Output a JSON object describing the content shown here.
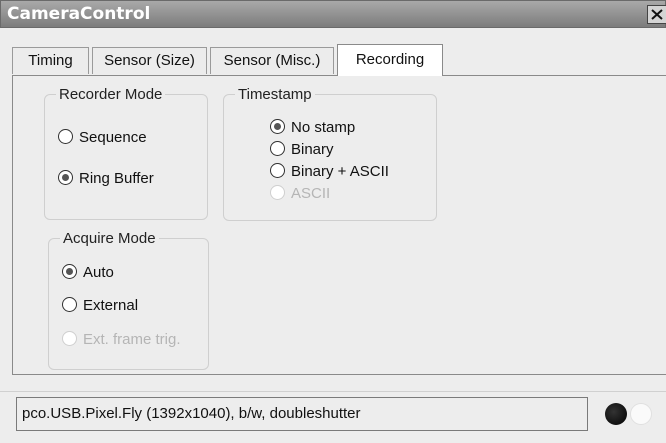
{
  "window": {
    "title": "CameraControl",
    "close_icon": "close-icon"
  },
  "tabs": [
    {
      "label": "Timing",
      "active": false
    },
    {
      "label": "Sensor (Size)",
      "active": false
    },
    {
      "label": "Sensor (Misc.)",
      "active": false
    },
    {
      "label": "Recording",
      "active": true
    }
  ],
  "recorder_mode": {
    "legend": "Recorder Mode",
    "options": [
      {
        "label": "Sequence",
        "checked": false,
        "enabled": true
      },
      {
        "label": "Ring Buffer",
        "checked": true,
        "enabled": true
      }
    ]
  },
  "timestamp": {
    "legend": "Timestamp",
    "options": [
      {
        "label": "No stamp",
        "checked": true,
        "enabled": true
      },
      {
        "label": "Binary",
        "checked": false,
        "enabled": true
      },
      {
        "label": "Binary + ASCII",
        "checked": false,
        "enabled": true
      },
      {
        "label": "ASCII",
        "checked": false,
        "enabled": false
      }
    ]
  },
  "acquire_mode": {
    "legend": "Acquire Mode",
    "options": [
      {
        "label": "Auto",
        "checked": true,
        "enabled": true
      },
      {
        "label": "External",
        "checked": false,
        "enabled": true
      },
      {
        "label": "Ext. frame trig.",
        "checked": false,
        "enabled": false
      }
    ]
  },
  "status": {
    "camera_info": "pco.USB.Pixel.Fly (1392x1040), b/w, doubleshutter",
    "indicators": [
      {
        "name": "status-led-active",
        "state": "on",
        "color": "#000000"
      },
      {
        "name": "status-led-inactive",
        "state": "off",
        "color": "#fafafa"
      }
    ]
  }
}
